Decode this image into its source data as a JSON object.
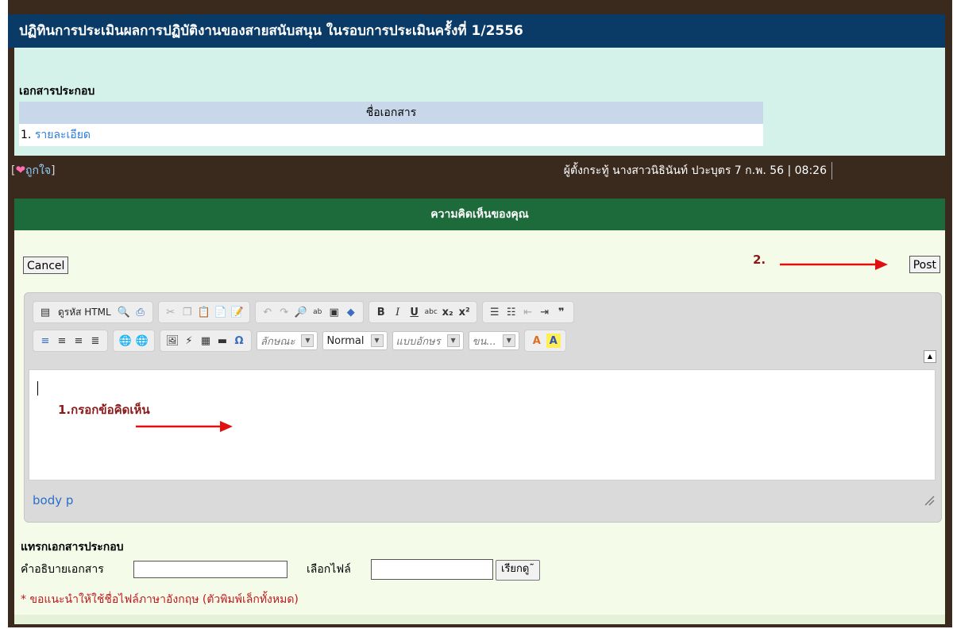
{
  "post": {
    "title": "ปฏิทินการประเมินผลการปฏิบัติงานของสายสนับสนุน ในรอบการประเมินครั้งที่ 1/2556",
    "attachments_title": "เอกสารประกอบ",
    "table_header": "ชื่อเอกสาร",
    "rows": [
      {
        "num": "1.",
        "link": "รายละเอียด"
      }
    ]
  },
  "author_bar": {
    "like_open": "[",
    "like_label": "ถูกใจ",
    "like_close": "]",
    "info": "ผู้ตั้งกระทู้ นางสาวนิธินันท์ ปวะบุตร 7 ก.พ. 56 | 08:26"
  },
  "comment": {
    "header": "ความคิดเห็นของคุณ",
    "cancel_label": "Cancel",
    "post_label": "Post",
    "annotation_2": "2.",
    "annotation_1": "1.กรอกข้อคิดเห็น",
    "editor": {
      "source_label": "ดูรหัส HTML",
      "style_combo": "ลักษณะ",
      "format_combo": "Normal",
      "font_combo": "แบบอักษร",
      "size_combo": "ขน...",
      "path": "body  p"
    }
  },
  "attach": {
    "title": "แทรกเอกสารประกอบ",
    "desc_label": "คำอธิบายเอกสาร",
    "desc_value": "",
    "file_label": "เลือกไฟล์",
    "file_value": "",
    "browse_label": "เรียกดู˜",
    "note": "* ขอแนะนำให้ใช้ชื่อไฟล์ภาษาอังกฤษ (ตัวพิมพ์เล็กทั้งหมด)"
  },
  "colors": {
    "title_bg": "#0a3a66",
    "comment_header_bg": "#1d6a3a",
    "frame_bg": "#3a2a1e",
    "annotation": "#8b1a1a",
    "arrow": "#e01010",
    "note": "#c0181c"
  }
}
